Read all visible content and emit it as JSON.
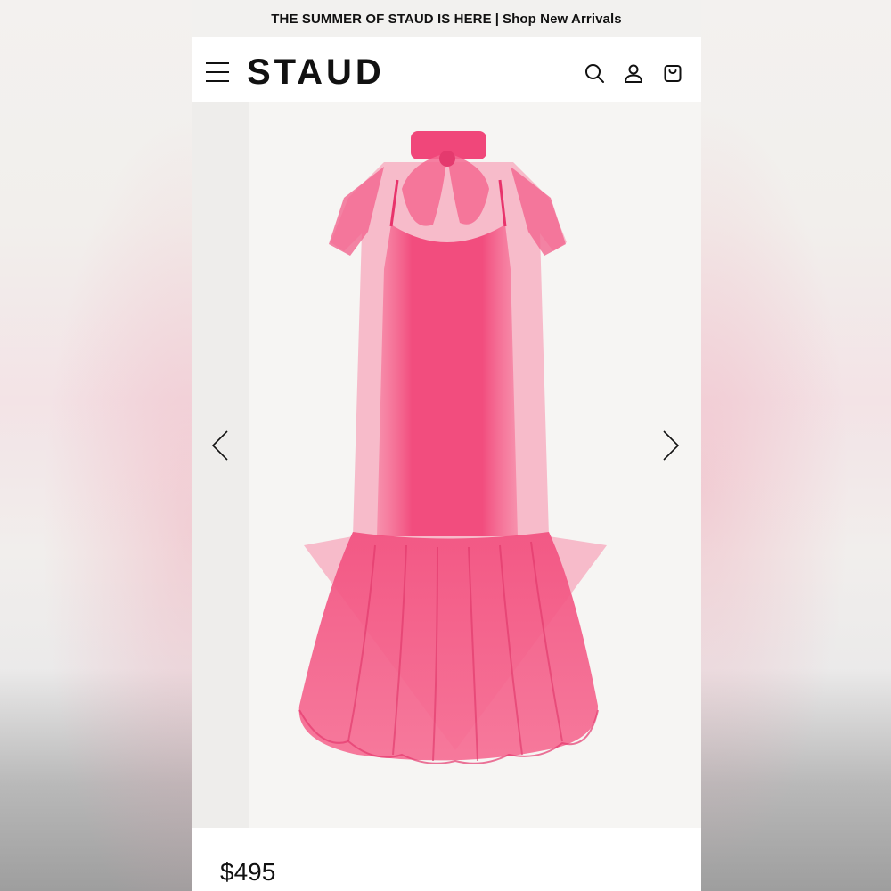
{
  "promo": {
    "headline": "THE SUMMER OF STAUD IS HERE",
    "separator": "|",
    "link": "Shop New Arrivals"
  },
  "header": {
    "logo": "STAUD",
    "icons": [
      "menu-icon",
      "search-icon",
      "account-icon",
      "bag-icon"
    ]
  },
  "gallery": {
    "image": "pink organza dress",
    "prev_icon": "chevron-left-icon",
    "next_icon": "chevron-right-icon"
  },
  "product": {
    "price": "$495"
  },
  "colors": {
    "dress": "#f0527f",
    "text": "#111111",
    "promo_bg": "#f2f1ef"
  }
}
